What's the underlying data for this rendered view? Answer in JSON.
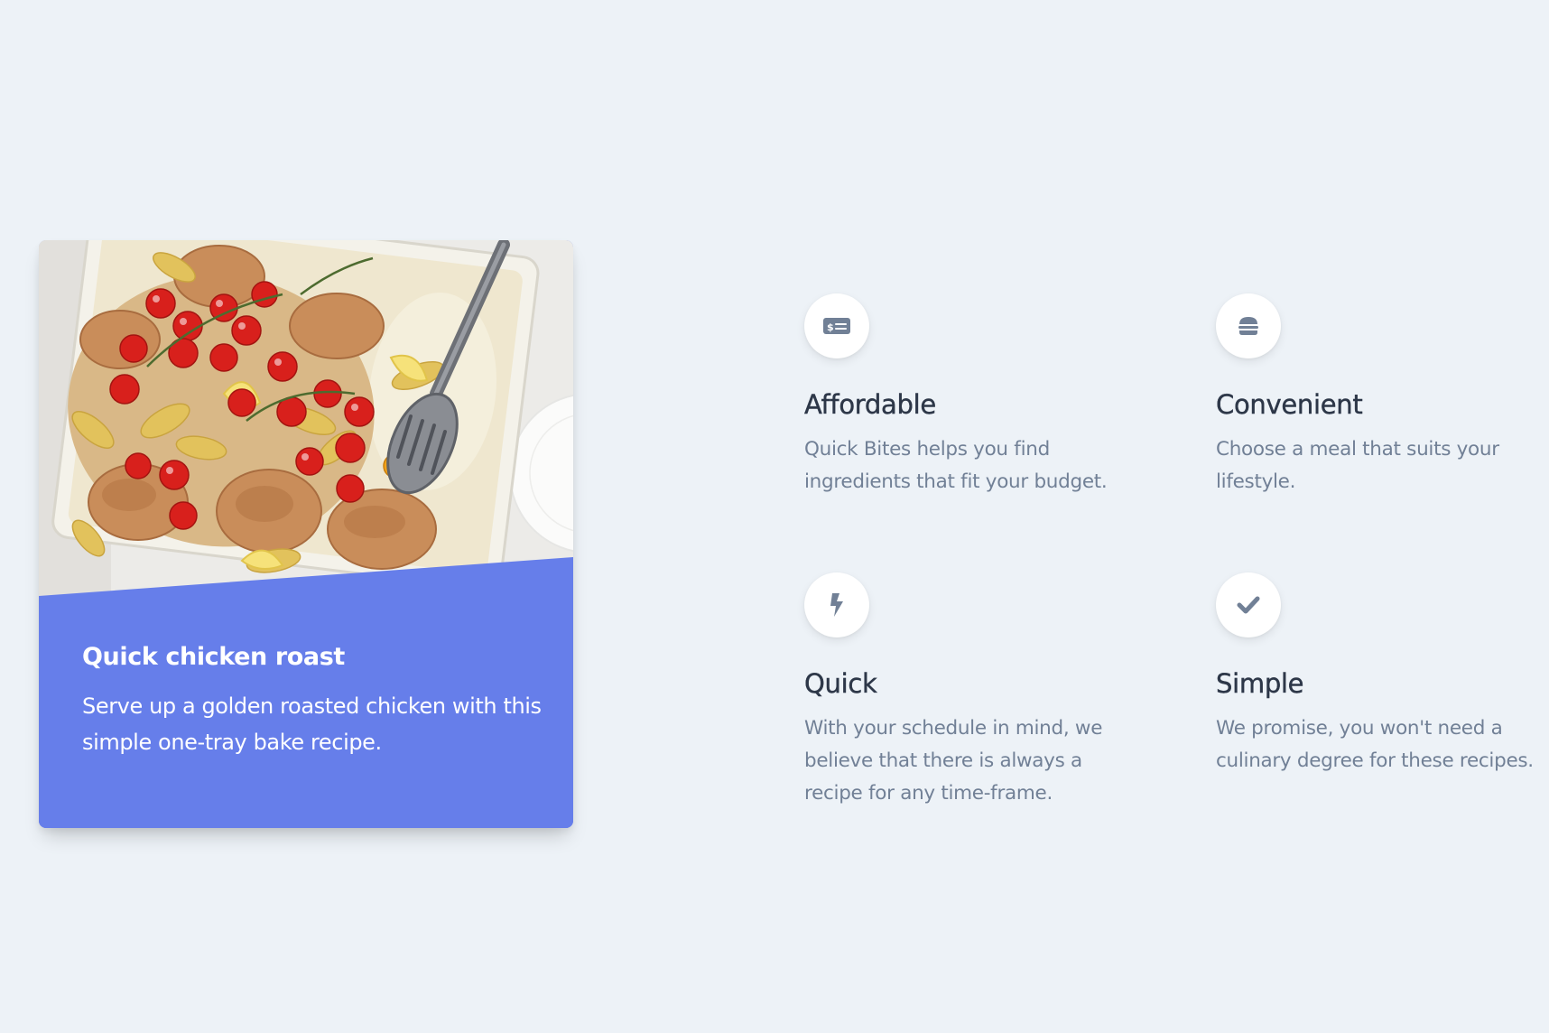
{
  "recipe_card": {
    "title": "Quick chicken roast",
    "description": "Serve up a golden roasted chicken with this simple one-tray bake recipe.",
    "image": "roast-chicken-tray-photo",
    "accent_color": "#667eea"
  },
  "features": [
    {
      "icon": "money-bill-icon",
      "title": "Affordable",
      "description": "Quick Bites helps you find ingredients that fit your budget."
    },
    {
      "icon": "hamburger-icon",
      "title": "Convenient",
      "description": "Choose a meal that suits your lifestyle."
    },
    {
      "icon": "bolt-icon",
      "title": "Quick",
      "description": "With your schedule in mind, we believe that there is always a recipe for any time-frame."
    },
    {
      "icon": "check-icon",
      "title": "Simple",
      "description": "We promise, you won't need a culinary degree for these recipes."
    }
  ],
  "colors": {
    "background": "#edf2f7",
    "heading": "#2d3748",
    "body_text": "#718096",
    "icon": "#718096",
    "card_accent": "#667eea"
  }
}
